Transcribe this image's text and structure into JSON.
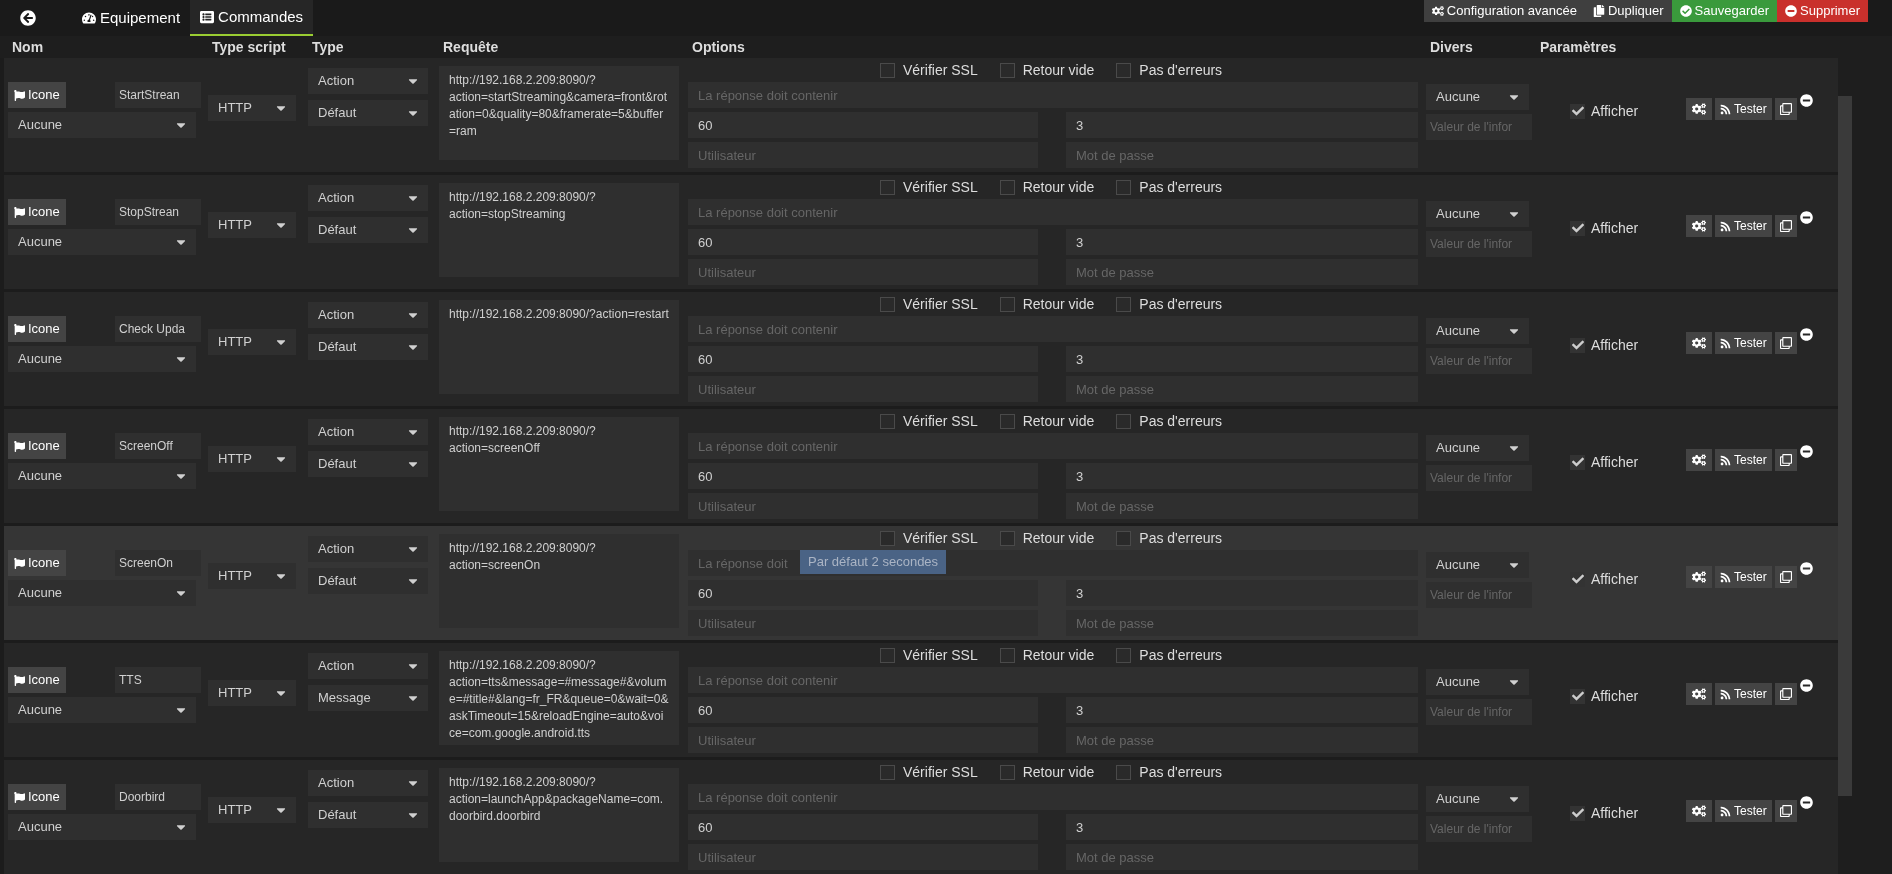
{
  "tabs": [
    {
      "label": "Equipement",
      "kind": "gauge",
      "selected": false
    },
    {
      "label": "Commandes",
      "kind": "list",
      "selected": true
    }
  ],
  "actions": [
    {
      "label": "Configuration avancée",
      "kind": "config"
    },
    {
      "label": "Dupliquer",
      "kind": "copy"
    },
    {
      "label": "Sauvegarder",
      "kind": "save"
    },
    {
      "label": "Supprimer",
      "kind": "delete"
    }
  ],
  "columns": [
    "Nom",
    "Type script",
    "Type",
    "Requête",
    "Options",
    "Divers",
    "Paramètres"
  ],
  "rows": [
    {
      "icon_button": "Icone",
      "name": "StartStrean",
      "icon_select": "Aucune",
      "script": "HTTP",
      "type": "Action",
      "subtype": "Défaut",
      "request": "http://192.168.2.209:8090/?action=startStreaming&camera=front&rotation=0&quality=80&framerate=5&buffer=ram",
      "checks": [
        {
          "label": "Vérifier SSL",
          "checked": false
        },
        {
          "label": "Retour vide",
          "checked": false
        },
        {
          "label": "Pas d'erreurs",
          "checked": false
        }
      ],
      "response_placeholder": "La réponse doit contenir",
      "timeout": "60",
      "retries": "3",
      "user_placeholder": "Utilisateur",
      "password_placeholder": "Mot de passe",
      "divers": "Aucune",
      "info_placeholder": "Valeur de l'infor",
      "show": {
        "label": "Afficher",
        "checked": true
      },
      "test": "Tester",
      "hovered": false
    },
    {
      "icon_button": "Icone",
      "name": "StopStrean",
      "icon_select": "Aucune",
      "script": "HTTP",
      "type": "Action",
      "subtype": "Défaut",
      "request": "http://192.168.2.209:8090/?action=stopStreaming",
      "checks": [
        {
          "label": "Vérifier SSL",
          "checked": false
        },
        {
          "label": "Retour vide",
          "checked": false
        },
        {
          "label": "Pas d'erreurs",
          "checked": false
        }
      ],
      "response_placeholder": "La réponse doit contenir",
      "timeout": "60",
      "retries": "3",
      "user_placeholder": "Utilisateur",
      "password_placeholder": "Mot de passe",
      "divers": "Aucune",
      "info_placeholder": "Valeur de l'infor",
      "show": {
        "label": "Afficher",
        "checked": true
      },
      "test": "Tester",
      "hovered": false
    },
    {
      "icon_button": "Icone",
      "name": "Check Upda",
      "icon_select": "Aucune",
      "script": "HTTP",
      "type": "Action",
      "subtype": "Défaut",
      "request": "http://192.168.2.209:8090/?action=restart",
      "checks": [
        {
          "label": "Vérifier SSL",
          "checked": false
        },
        {
          "label": "Retour vide",
          "checked": false
        },
        {
          "label": "Pas d'erreurs",
          "checked": false
        }
      ],
      "response_placeholder": "La réponse doit contenir",
      "timeout": "60",
      "retries": "3",
      "user_placeholder": "Utilisateur",
      "password_placeholder": "Mot de passe",
      "divers": "Aucune",
      "info_placeholder": "Valeur de l'infor",
      "show": {
        "label": "Afficher",
        "checked": true
      },
      "test": "Tester",
      "hovered": false
    },
    {
      "icon_button": "Icone",
      "name": "ScreenOff",
      "icon_select": "Aucune",
      "script": "HTTP",
      "type": "Action",
      "subtype": "Défaut",
      "request": "http://192.168.2.209:8090/?action=screenOff",
      "checks": [
        {
          "label": "Vérifier SSL",
          "checked": false
        },
        {
          "label": "Retour vide",
          "checked": false
        },
        {
          "label": "Pas d'erreurs",
          "checked": false
        }
      ],
      "response_placeholder": "La réponse doit contenir",
      "timeout": "60",
      "retries": "3",
      "user_placeholder": "Utilisateur",
      "password_placeholder": "Mot de passe",
      "divers": "Aucune",
      "info_placeholder": "Valeur de l'infor",
      "show": {
        "label": "Afficher",
        "checked": true
      },
      "test": "Tester",
      "hovered": false
    },
    {
      "icon_button": "Icone",
      "name": "ScreenOn",
      "icon_select": "Aucune",
      "script": "HTTP",
      "type": "Action",
      "subtype": "Défaut",
      "request": "http://192.168.2.209:8090/?action=screenOn",
      "checks": [
        {
          "label": "Vérifier SSL",
          "checked": false
        },
        {
          "label": "Retour vide",
          "checked": false
        },
        {
          "label": "Pas d'erreurs",
          "checked": false
        }
      ],
      "response_placeholder": "La réponse doit",
      "tooltip": "Par défaut 2 secondes",
      "timeout": "60",
      "retries": "3",
      "user_placeholder": "Utilisateur",
      "password_placeholder": "Mot de passe",
      "divers": "Aucune",
      "info_placeholder": "Valeur de l'infor",
      "show": {
        "label": "Afficher",
        "checked": true
      },
      "test": "Tester",
      "hovered": true
    },
    {
      "icon_button": "Icone",
      "name": "TTS",
      "icon_select": "Aucune",
      "script": "HTTP",
      "type": "Action",
      "subtype": "Message",
      "request": "http://192.168.2.209:8090/?action=tts&message=#message#&volume=#title#&lang=fr_FR&queue=0&wait=0&askTimeout=15&reloadEngine=auto&voice=com.google.android.tts",
      "checks": [
        {
          "label": "Vérifier SSL",
          "checked": false
        },
        {
          "label": "Retour vide",
          "checked": false
        },
        {
          "label": "Pas d'erreurs",
          "checked": false
        }
      ],
      "response_placeholder": "La réponse doit contenir",
      "timeout": "60",
      "retries": "3",
      "user_placeholder": "Utilisateur",
      "password_placeholder": "Mot de passe",
      "divers": "Aucune",
      "info_placeholder": "Valeur de l'infor",
      "show": {
        "label": "Afficher",
        "checked": true
      },
      "test": "Tester",
      "hovered": false
    },
    {
      "icon_button": "Icone",
      "name": "Doorbird",
      "icon_select": "Aucune",
      "script": "HTTP",
      "type": "Action",
      "subtype": "Défaut",
      "request": "http://192.168.2.209:8090/?action=launchApp&packageName=com.doorbird.doorbird",
      "checks": [
        {
          "label": "Vérifier SSL",
          "checked": false
        },
        {
          "label": "Retour vide",
          "checked": false
        },
        {
          "label": "Pas d'erreurs",
          "checked": false
        }
      ],
      "response_placeholder": "La réponse doit contenir",
      "timeout": "60",
      "retries": "3",
      "user_placeholder": "Utilisateur",
      "password_placeholder": "Mot de passe",
      "divers": "Aucune",
      "info_placeholder": "Valeur de l'infor",
      "show": {
        "label": "Afficher",
        "checked": true
      },
      "test": "Tester",
      "hovered": false
    }
  ]
}
